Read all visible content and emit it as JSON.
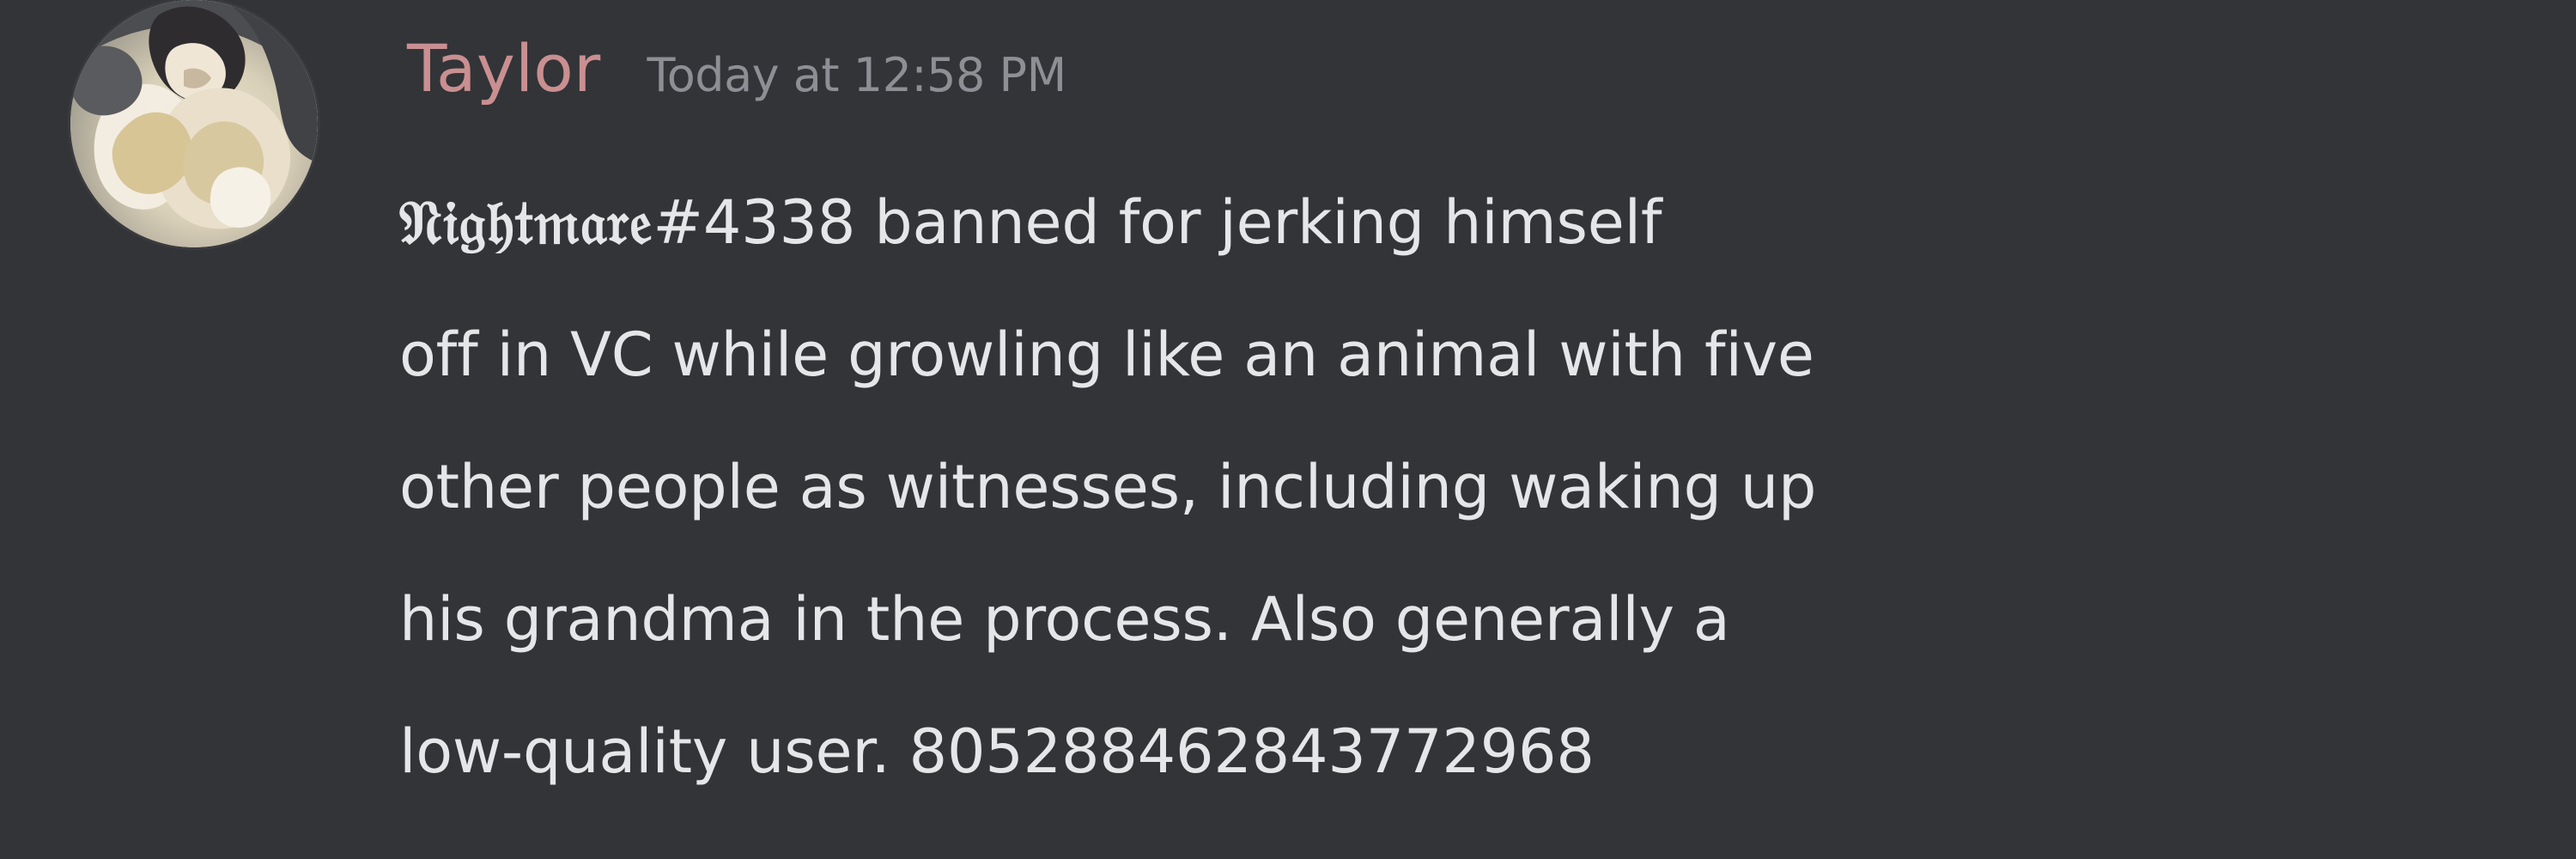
{
  "message": {
    "author": {
      "name": "Taylor",
      "timestamp": "Today at 12:58 PM",
      "avatar_icon": "user-avatar-icon"
    },
    "content": {
      "mention_name": "𝔑𝔦𝔤𝔥𝔱𝔪𝔞𝔯𝔢",
      "mention_tag": "#4338",
      "line_1_rest": " banned for jerking himself",
      "line_2": "off in VC while growling like an animal with five",
      "line_3": "other people as witnesses, including waking up",
      "line_4": "his grandma in the process. Also generally a",
      "line_5": "low-quality user. 805288462843772968"
    }
  },
  "colors": {
    "background": "#323438",
    "username": "#c98f91",
    "timestamp": "#8d8f94",
    "message_text": "#e5e6e8"
  }
}
